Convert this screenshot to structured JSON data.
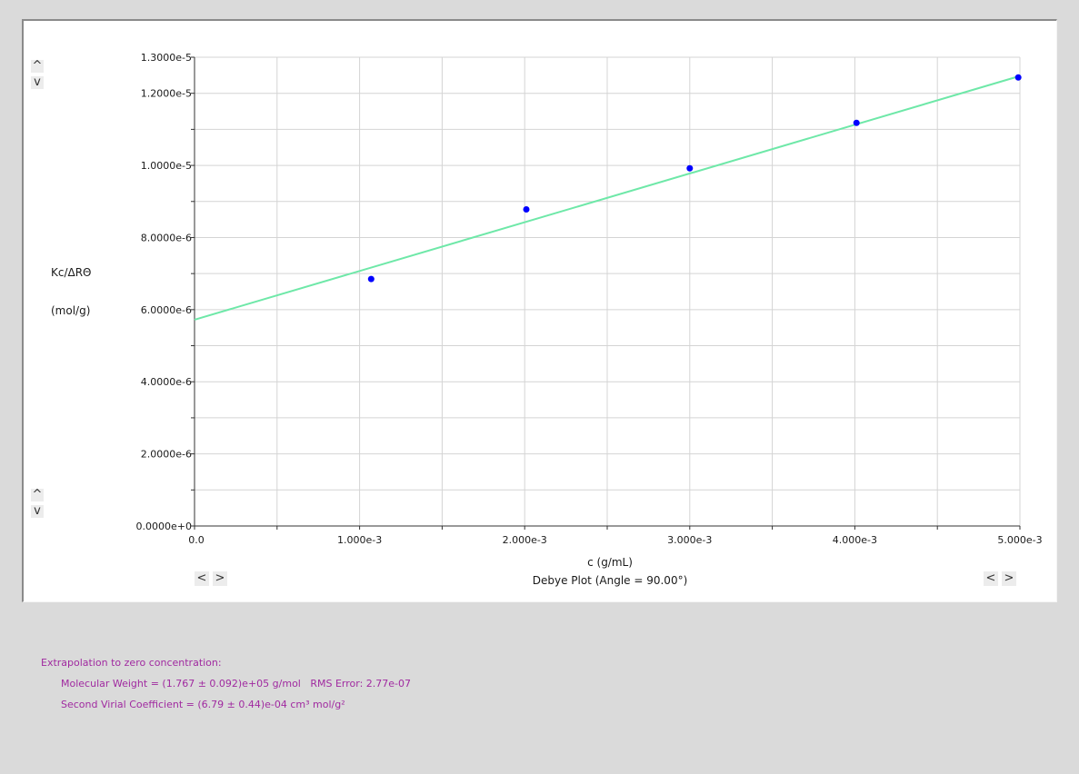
{
  "chart_data": {
    "type": "scatter",
    "title": "Debye Plot (Angle = 90.00°)",
    "xlabel": "c (g/mL)",
    "ylabel": [
      "Kc/ΔRΘ",
      "(mol/g)"
    ],
    "xlim": [
      0.0,
      0.005
    ],
    "ylim": [
      0.0,
      1.3e-05
    ],
    "x_ticks": [
      {
        "value": 0.0,
        "label": "0.0"
      },
      {
        "value": 0.001,
        "label": "1.000e-3"
      },
      {
        "value": 0.002,
        "label": "2.000e-3"
      },
      {
        "value": 0.003,
        "label": "3.000e-3"
      },
      {
        "value": 0.004,
        "label": "4.000e-3"
      },
      {
        "value": 0.005,
        "label": "5.000e-3"
      }
    ],
    "y_ticks": [
      {
        "value": 0.0,
        "label": "0.0000e+0"
      },
      {
        "value": 2e-06,
        "label": "2.0000e-6"
      },
      {
        "value": 4e-06,
        "label": "4.0000e-6"
      },
      {
        "value": 6e-06,
        "label": "6.0000e-6"
      },
      {
        "value": 8e-06,
        "label": "8.0000e-6"
      },
      {
        "value": 1e-05,
        "label": "1.0000e-5"
      },
      {
        "value": 1.2e-05,
        "label": "1.2000e-5"
      },
      {
        "value": 1.3e-05,
        "label": "1.3000e-5"
      }
    ],
    "grid": true,
    "series": [
      {
        "kind": "points",
        "color": "#0000ff",
        "points": [
          {
            "x": 0.00107,
            "y": 6.85e-06
          },
          {
            "x": 0.00201,
            "y": 8.78e-06
          },
          {
            "x": 0.003,
            "y": 9.92e-06
          },
          {
            "x": 0.00401,
            "y": 1.118e-05
          },
          {
            "x": 0.00499,
            "y": 1.244e-05
          }
        ]
      },
      {
        "kind": "fit-line",
        "color": "#6ee8a8",
        "points": [
          {
            "x": 0.0,
            "y": 5.72e-06
          },
          {
            "x": 0.005,
            "y": 1.248e-05
          }
        ]
      }
    ]
  },
  "controls": {
    "up_glyph": "^",
    "down_glyph": "v",
    "left_glyph": "<",
    "right_glyph": ">"
  },
  "results": {
    "heading": "Extrapolation to zero concentration:",
    "line1": "Molecular Weight = (1.767 ± 0.092)e+05 g/mol   RMS Error: 2.77e-07",
    "line2": "Second Virial Coefficient = (6.79 ± 0.44)e-04 cm³ mol/g²",
    "color": "#a02aa0"
  }
}
